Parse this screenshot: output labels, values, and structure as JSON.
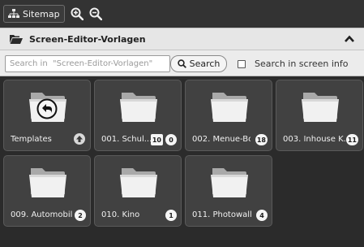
{
  "toolbar": {
    "sitemap_label": "Sitemap"
  },
  "panel": {
    "title": "Screen-Editor-Vorlagen"
  },
  "search": {
    "placeholder": "Search in  \"Screen-Editor-Vorlagen\"",
    "value": "",
    "button_label": "Search",
    "checkbox_label": "Search in screen info",
    "checkbox_checked": false
  },
  "folders": [
    {
      "label": "Templates",
      "badges": [],
      "is_parent": true
    },
    {
      "label": "001. Schul...",
      "badges": [
        "10",
        "0"
      ]
    },
    {
      "label": "002. Menue-Bo...",
      "badges": [
        "18"
      ]
    },
    {
      "label": "003. Inhouse K...",
      "badges": [
        "11"
      ]
    },
    {
      "label": "009. Automobil",
      "badges": [
        "2"
      ]
    },
    {
      "label": "010. Kino",
      "badges": [
        "1"
      ]
    },
    {
      "label": "011. Photowall",
      "badges": [
        "4"
      ]
    }
  ],
  "icons": {
    "sitemap": "sitemap-icon",
    "zoom_in": "zoom-in-icon",
    "zoom_out": "zoom-out-icon",
    "folder_open": "folder-open-icon",
    "collapse": "chevron-up-icon",
    "search": "search-icon",
    "folder": "folder-icon",
    "back": "back-arrow-icon",
    "up": "arrow-up-icon"
  },
  "colors": {
    "background": "#2b2b2b",
    "tile": "#414141",
    "panel_header": "#e6e6e6"
  }
}
